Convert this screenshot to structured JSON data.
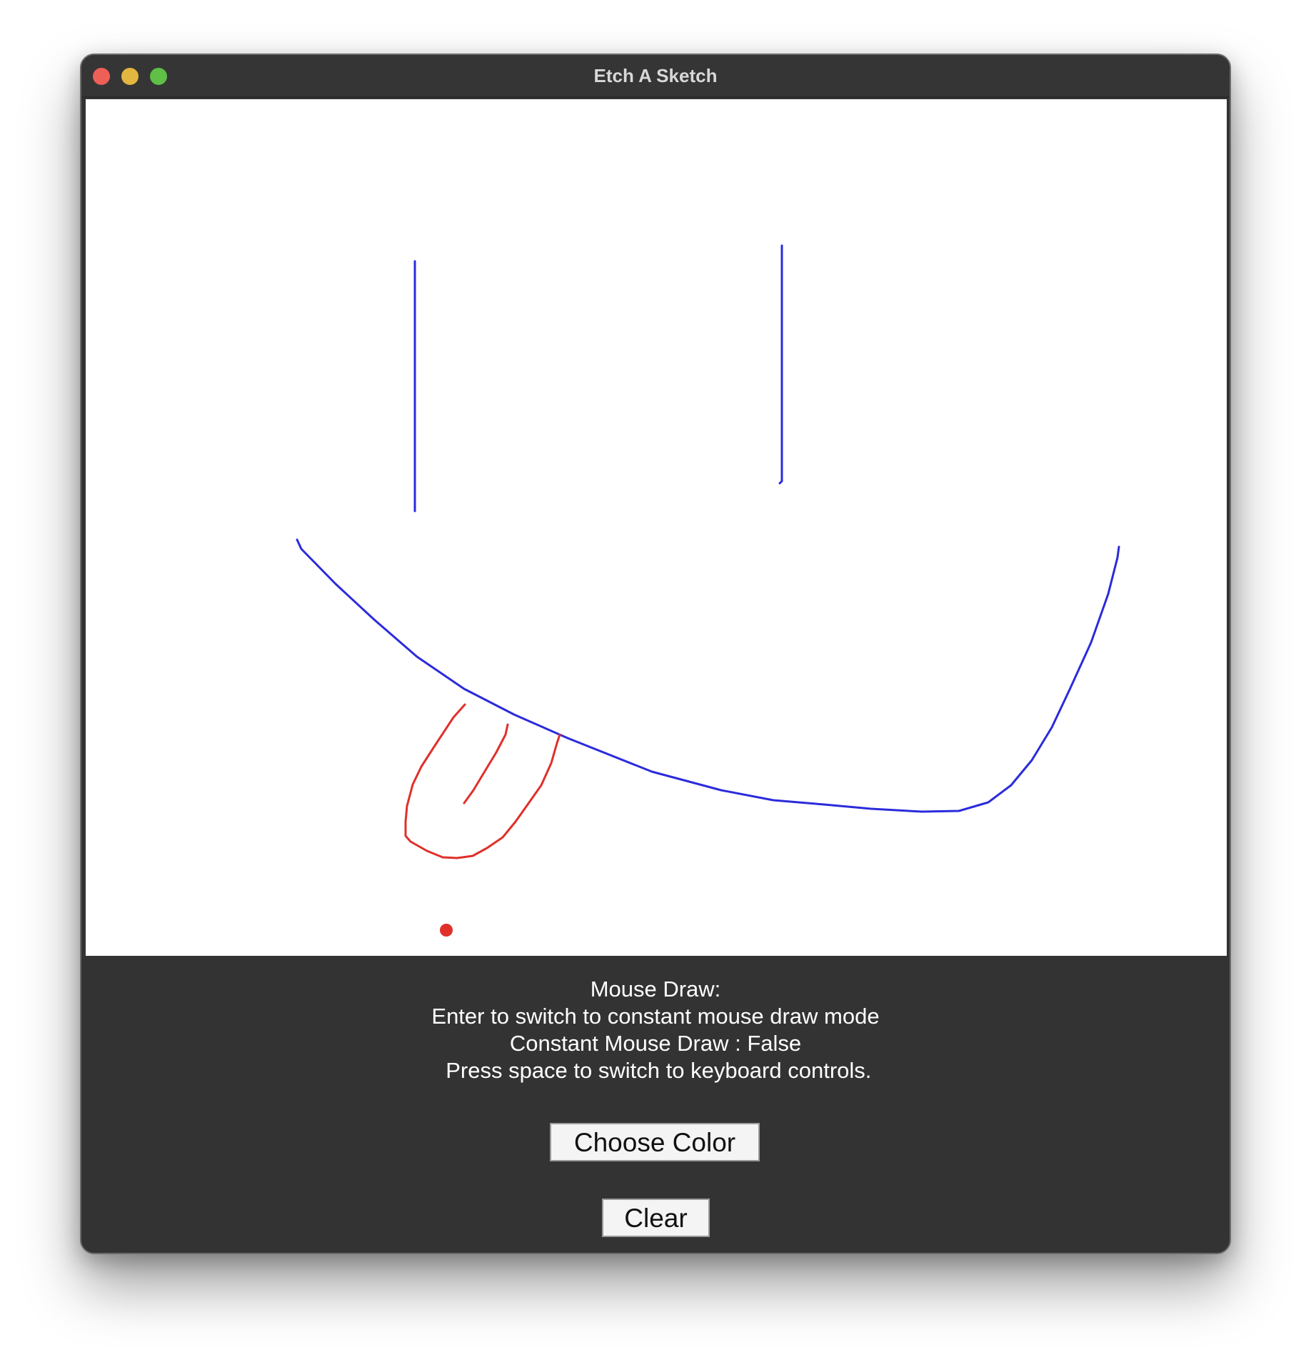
{
  "window": {
    "title": "Etch A Sketch",
    "traffic_lights": [
      {
        "name": "close",
        "color": "#ee5f57"
      },
      {
        "name": "minimize",
        "color": "#e2b73f"
      },
      {
        "name": "maximize",
        "color": "#5fbf47"
      }
    ]
  },
  "canvas": {
    "background": "#ffffff",
    "stroke_colors": {
      "blue": "#2b2bdc",
      "red": "#e0302a"
    }
  },
  "info": {
    "line1": "Mouse Draw:",
    "line2": "Enter to switch to constant mouse draw mode",
    "line3": "Constant Mouse Draw : False",
    "line4": " Press space to switch to keyboard controls."
  },
  "buttons": {
    "choose_color": "Choose Color",
    "clear": "Clear"
  }
}
